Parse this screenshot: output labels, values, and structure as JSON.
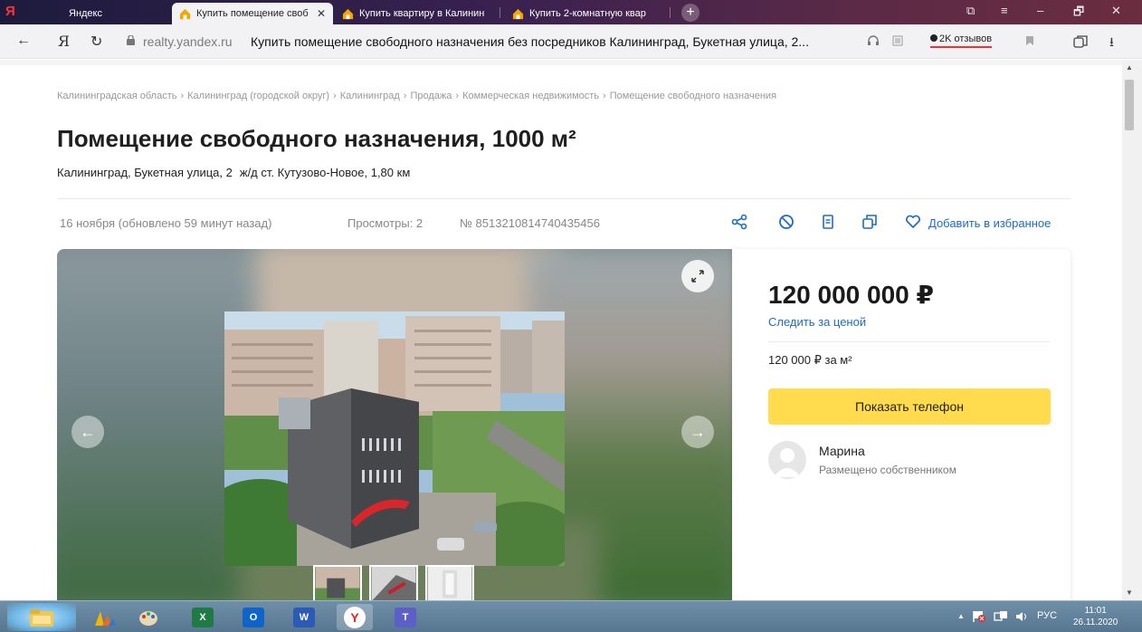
{
  "browser": {
    "logo": "Я",
    "tabs": [
      {
        "label": "Яндекс"
      },
      {
        "label": "Купить помещение своб",
        "close": "✕"
      },
      {
        "label": "Купить квартиру в Калинин"
      },
      {
        "label": "Купить 2-комнатную квар"
      }
    ],
    "new_tab": "+",
    "window_controls": [
      "⧉",
      "≡",
      "–",
      "🗗",
      "✕"
    ],
    "nav": {
      "back": "←",
      "yandex": "Я",
      "reload": "↻"
    },
    "url_domain": "realty.yandex.ru",
    "page_title": "Купить помещение свободного назначения без посредников Калининград, Букетная улица, 2...",
    "reviews": "2K отзывов",
    "download": "⭳"
  },
  "listing": {
    "breadcrumbs": [
      "Калининградская область",
      "Калининград (городской округ)",
      "Калининград",
      "Продажа",
      "Коммерческая недвижимость",
      "Помещение свободного назначения"
    ],
    "breadcrumb_sep": "›",
    "title": "Помещение свободного назначения, 1000 м²",
    "address": "Калининград, Букетная улица, 2",
    "station": "ж/д ст. Кутузово-Новое, 1,80 км",
    "date": "16 ноября (обновлено 59 минут назад)",
    "views": "Просмотры: 2",
    "id": "№ 8513210814740435456",
    "add_to_favorites": "Добавить в избранное",
    "accent_color": "#1e6cc7"
  },
  "gallery": {
    "prev": "←",
    "next": "→"
  },
  "card": {
    "price": "120 000 000 ₽",
    "follow_price": "Следить за ценой",
    "price_per_m": "120 000 ₽ за м²",
    "show_phone": "Показать телефон",
    "seller_name": "Марина",
    "seller_role": "Размещено собственником",
    "button_color": "#ffdb4d"
  },
  "taskbar": {
    "tray_arrow": "▲",
    "language": "РУС",
    "time": "11:01",
    "date": "26.11.2020",
    "apps": [
      {
        "name": "explorer",
        "letter": ""
      },
      {
        "name": "chart-app",
        "letter": ""
      },
      {
        "name": "paint",
        "letter": ""
      },
      {
        "name": "excel",
        "letter": "X"
      },
      {
        "name": "outlook",
        "letter": "O"
      },
      {
        "name": "word",
        "letter": "W"
      },
      {
        "name": "yandex-browser",
        "letter": "Y"
      },
      {
        "name": "teams",
        "letter": "T"
      }
    ]
  }
}
